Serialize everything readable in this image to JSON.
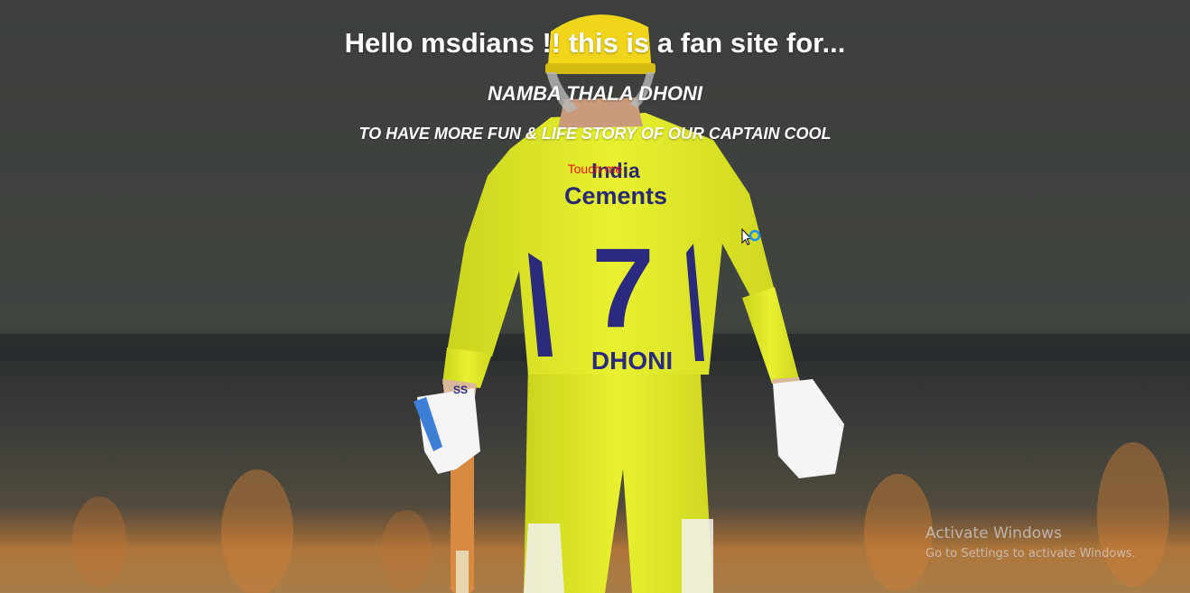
{
  "hero": {
    "title": "Hello msdians !! this is a fan site for...",
    "subtitle": "NAMBA THALA DHONI",
    "tagline": "TO HAVE MORE FUN & LIFE STORY OF OUR CAPTAIN COOL",
    "link_label": "Touch me",
    "link_color": "#e8141c"
  },
  "photo": {
    "jersey_sponsor_line1": "India",
    "jersey_sponsor_line2": "Cements",
    "jersey_number": "7",
    "jersey_name": "DHONI",
    "glove_brand": "SS",
    "jersey_color": "#e2ec2c",
    "helmet_color": "#f0d51a"
  },
  "os_watermark": {
    "title": "Activate Windows",
    "subtitle": "Go to Settings to activate Windows."
  }
}
